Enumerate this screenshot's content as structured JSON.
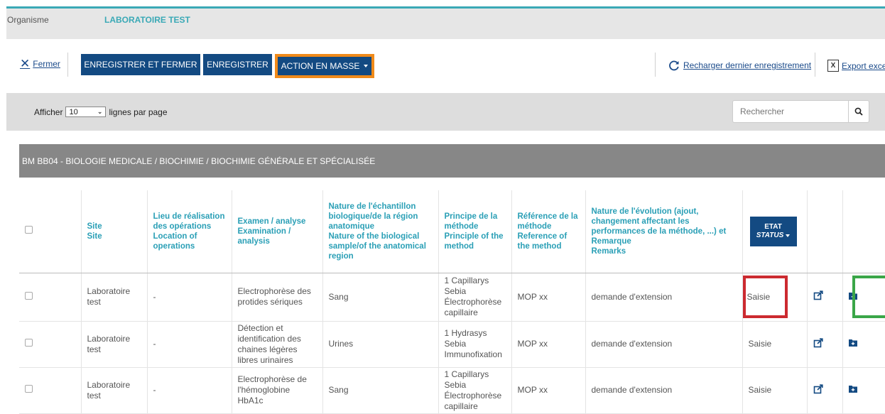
{
  "header": {
    "organisme_label": "Organisme",
    "organisme_value": "LABORATOIRE TEST"
  },
  "toolbar": {
    "close_label": "Fermer",
    "save_close_label": "ENREGISTRER ET FERMER",
    "save_label": "ENREGISTRER",
    "mass_action_label": "ACTION EN MASSE",
    "reload_label": "Recharger dernier enregistrement",
    "export_label": "Export excel"
  },
  "filter": {
    "show_label": "Afficher",
    "page_size": "10",
    "per_page_label": "lignes par page",
    "search_placeholder": "Rechercher"
  },
  "section": {
    "title": "BM BB04 - BIOLOGIE MEDICALE / BIOCHIMIE / BIOCHIMIE GÉNÉRALE ET SPÉCIALISÉE"
  },
  "table": {
    "columns": {
      "site": "Site",
      "site_en": "Site",
      "lieu": "Lieu de réalisation des opérations",
      "lieu_en": "Location of operations",
      "examen": "Examen / analyse",
      "examen_en": "Examination / analysis",
      "nature": "Nature de l'échantillon biologique/de la région anatomique",
      "nature_en": "Nature of the biological sample/of the anatomical region",
      "principe": "Principe de la méthode",
      "principe_en": "Principle of the method",
      "reference": "Référence de la méthode",
      "reference_en": "Reference of the method",
      "evolution": "Nature de l'évolution (ajout, changement affectant les performances de la méthode, ...) et Remarque",
      "evolution_en": "Remarks",
      "etat": "ETAT",
      "etat_en": "STATUS"
    },
    "rows": [
      {
        "site": "Laboratoire test",
        "lieu": "-",
        "examen": "Electrophorèse des protides sériques",
        "nature": "Sang",
        "principe": "1 Capillarys Sebia Électrophorèse capillaire",
        "reference": "MOP xx",
        "evolution": "demande d'extension",
        "etat": "Saisie"
      },
      {
        "site": "Laboratoire test",
        "lieu": "-",
        "examen": "Détection et identification des chaines légères libres urinaires",
        "nature": "Urines",
        "principe": "1 Hydrasys Sebia Immunofixation",
        "reference": "MOP xx",
        "evolution": "demande d'extension",
        "etat": "Saisie"
      },
      {
        "site": "Laboratoire test",
        "lieu": "-",
        "examen": "Electrophorèse de l'hémoglobine HbA1c",
        "nature": "Sang",
        "principe": "1 Capillarys Sebia Électrophorèse capillaire",
        "reference": "MOP xx",
        "evolution": "demande d'extension",
        "etat": "Saisie"
      }
    ]
  },
  "colors": {
    "accent": "#3aa9b6",
    "primary": "#134a82",
    "highlight_orange": "#f08a1a",
    "highlight_red": "#cc2a30",
    "highlight_green": "#3aa648"
  }
}
